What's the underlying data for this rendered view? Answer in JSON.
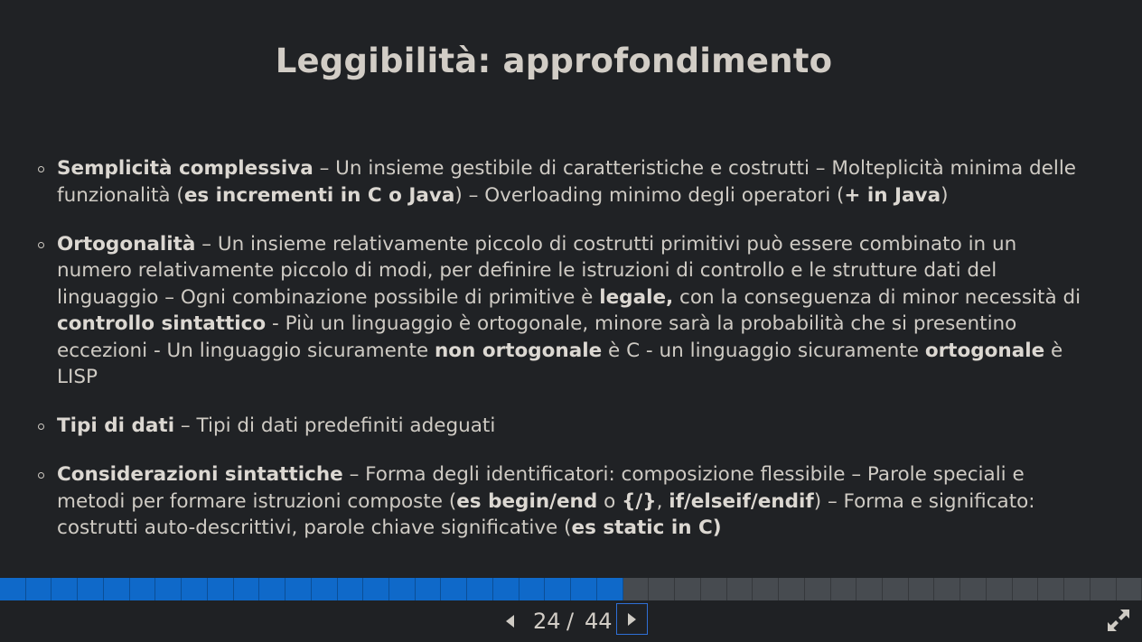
{
  "slide": {
    "title": "Leggibilità: approfondimento",
    "bullets": [
      {
        "parts": [
          {
            "text": "Semplicità complessiva",
            "bold": true
          },
          {
            "text": " – Un insieme gestibile di caratteristiche e costrutti – Molteplicità minima delle funzionalità (",
            "bold": false
          },
          {
            "text": "es incrementi in C o Java",
            "bold": true
          },
          {
            "text": ") – Overloading minimo degli operatori (",
            "bold": false
          },
          {
            "text": "+ in Java",
            "bold": true
          },
          {
            "text": ")",
            "bold": false
          }
        ]
      },
      {
        "parts": [
          {
            "text": "Ortogonalità",
            "bold": true
          },
          {
            "text": " – Un insieme relativamente piccolo di costrutti primitivi può essere combinato in un numero relativamente piccolo di modi, per definire le istruzioni di controllo e le strutture dati del linguaggio – Ogni combinazione possibile di primitive è ",
            "bold": false
          },
          {
            "text": "legale,",
            "bold": true
          },
          {
            "text": " con la conseguenza di minor necessità di ",
            "bold": false
          },
          {
            "text": "controllo sintattico",
            "bold": true
          },
          {
            "text": " - Più un linguaggio è ortogonale, minore sarà la probabilità che si presentino eccezioni - Un linguaggio sicuramente ",
            "bold": false
          },
          {
            "text": "non ortogonale",
            "bold": true
          },
          {
            "text": " è C - un linguaggio sicuramente ",
            "bold": false
          },
          {
            "text": "ortogonale",
            "bold": true
          },
          {
            "text": " è LISP",
            "bold": false
          }
        ]
      },
      {
        "parts": [
          {
            "text": "Tipi di dati",
            "bold": true
          },
          {
            "text": " – Tipi di dati predefiniti adeguati",
            "bold": false
          }
        ]
      },
      {
        "parts": [
          {
            "text": "Considerazioni sintattiche",
            "bold": true
          },
          {
            "text": " – Forma degli identificatori: composizione flessibile – Parole speciali e metodi per formare istruzioni composte (",
            "bold": false
          },
          {
            "text": "es begin/end",
            "bold": true
          },
          {
            "text": " o ",
            "bold": false
          },
          {
            "text": "{/}",
            "bold": true
          },
          {
            "text": ", ",
            "bold": false
          },
          {
            "text": "if/elseif/endif",
            "bold": true
          },
          {
            "text": ") – Forma e significato: costrutti auto-descrittivi, parole chiave significative (",
            "bold": false
          },
          {
            "text": "es static in C)",
            "bold": true
          }
        ]
      }
    ]
  },
  "navigation": {
    "current_page": "24",
    "separator": "/",
    "total_pages": "44",
    "prev_icon": "triangle-left-icon",
    "next_icon": "triangle-right-icon",
    "fullscreen_icon": "fullscreen-expand-icon"
  },
  "progress": {
    "total_segments": 44,
    "completed_segments": 24,
    "active_color": "#0f69c9",
    "inactive_color": "#474b50",
    "focus_color": "#2f6fd6"
  }
}
